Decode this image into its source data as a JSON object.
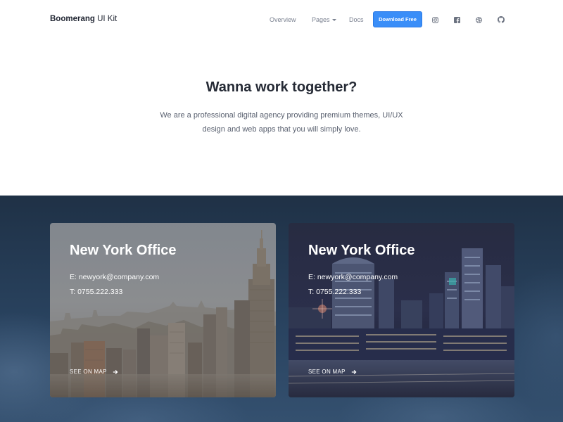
{
  "brand": {
    "bold": "Boomerang",
    "light": " UI Kit"
  },
  "nav": {
    "overview": "Overview",
    "pages": "Pages",
    "docs": "Docs",
    "download": "Download Free",
    "social_icons": [
      "instagram-icon",
      "facebook-icon",
      "dribbble-icon",
      "github-icon"
    ]
  },
  "hero": {
    "title": "Wanna work together?",
    "text": "We are a professional digital agency providing premium themes, UI/UX design and web apps that you will simply love."
  },
  "cards": [
    {
      "title": "New York Office",
      "email": "E: newyork@company.com",
      "phone": "T: 0755.222.333",
      "map_link": "SEE ON MAP"
    },
    {
      "title": "New York Office",
      "email": "E: newyork@company.com",
      "phone": "T: 0755.222.333",
      "map_link": "SEE ON MAP"
    }
  ],
  "colors": {
    "primary": "#3a8ef8",
    "dark_bg": "#26405b",
    "heading": "#252a35"
  }
}
